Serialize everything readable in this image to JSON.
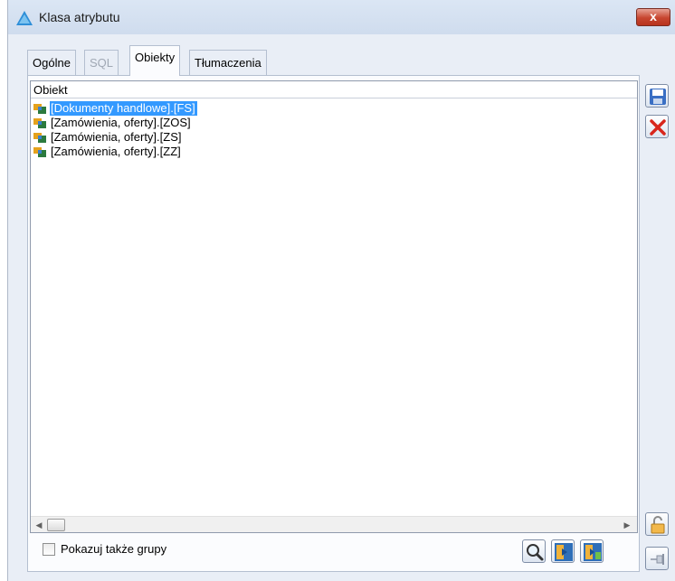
{
  "window": {
    "title": "Klasa atrybutu",
    "close_label": "x"
  },
  "tabs": [
    {
      "label": "Ogólne",
      "state": "normal"
    },
    {
      "label": "SQL",
      "state": "disabled"
    },
    {
      "label": "Obiekty",
      "state": "active"
    },
    {
      "label": "Tłumaczenia",
      "state": "normal"
    }
  ],
  "list": {
    "header": "Obiekt",
    "items": [
      {
        "label": "[Dokumenty handlowe].[FS]",
        "selected": true
      },
      {
        "label": "[Zamówienia, oferty].[ZOS]",
        "selected": false
      },
      {
        "label": "[Zamówienia, oferty].[ZS]",
        "selected": false
      },
      {
        "label": "[Zamówienia, oferty].[ZZ]",
        "selected": false
      }
    ]
  },
  "footer": {
    "show_groups_label": "Pokazuj także grupy",
    "show_groups_checked": false
  },
  "icons": {
    "save": "floppy-disk-icon",
    "delete": "red-x-icon",
    "search": "magnifier-icon",
    "add": "add-object-icon",
    "add_group": "add-group-icon",
    "lock": "padlock-icon",
    "pin": "pin-icon"
  },
  "colors": {
    "selection": "#3399ff",
    "close_button": "#c7452f",
    "titlebar": "#d6e2f2"
  }
}
